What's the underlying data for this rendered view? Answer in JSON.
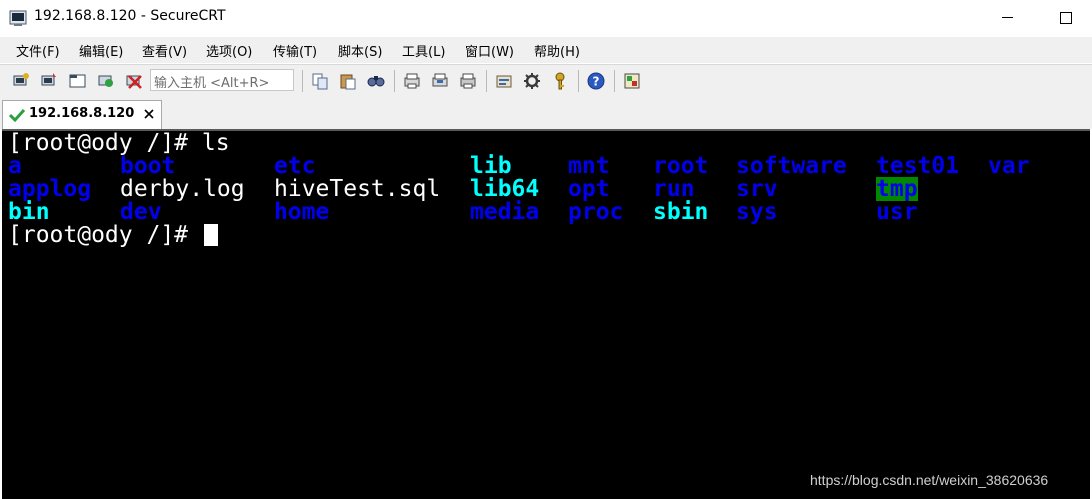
{
  "window": {
    "title": "192.168.8.120 - SecureCRT"
  },
  "menu": {
    "items": [
      "文件(F)",
      "编辑(E)",
      "查看(V)",
      "选项(O)",
      "传输(T)",
      "脚本(S)",
      "工具(L)",
      "窗口(W)",
      "帮助(H)"
    ]
  },
  "toolbar": {
    "quick_connect_placeholder": "输入主机 <Alt+R>",
    "icons": [
      "connect-icon",
      "quick-connect-icon",
      "connect-in-tab-icon",
      "reconnect-icon",
      "disconnect-icon",
      "copy-icon",
      "paste-icon",
      "find-icon",
      "print-setup-icon",
      "print-screen-icon",
      "print-icon",
      "session-options-icon",
      "global-options-icon",
      "key-icon",
      "help-icon",
      "map-icon"
    ]
  },
  "tab": {
    "label": "192.168.8.120"
  },
  "terminal": {
    "prompt_line_1": "[root@ody /]# ls",
    "prompt_line_2": "[root@ody /]# ",
    "listing": {
      "row1": [
        "a",
        "boot",
        "etc",
        "lib",
        "mnt",
        "root",
        "software",
        "test01",
        "var"
      ],
      "row2": [
        "applog",
        "derby.log",
        "hiveTest.sql",
        "lib64",
        "opt",
        "run",
        "srv",
        "tmp"
      ],
      "row3": [
        "bin",
        "dev",
        "home",
        "media",
        "proc",
        "sbin",
        "sys",
        "usr"
      ]
    },
    "colors": {
      "directory": "#0000ee",
      "symlink": "#00ffff",
      "file": "#ffffff",
      "sticky_dir_bg": "#008800",
      "background": "#000000"
    }
  },
  "watermark": "https://blog.csdn.net/weixin_38620636"
}
